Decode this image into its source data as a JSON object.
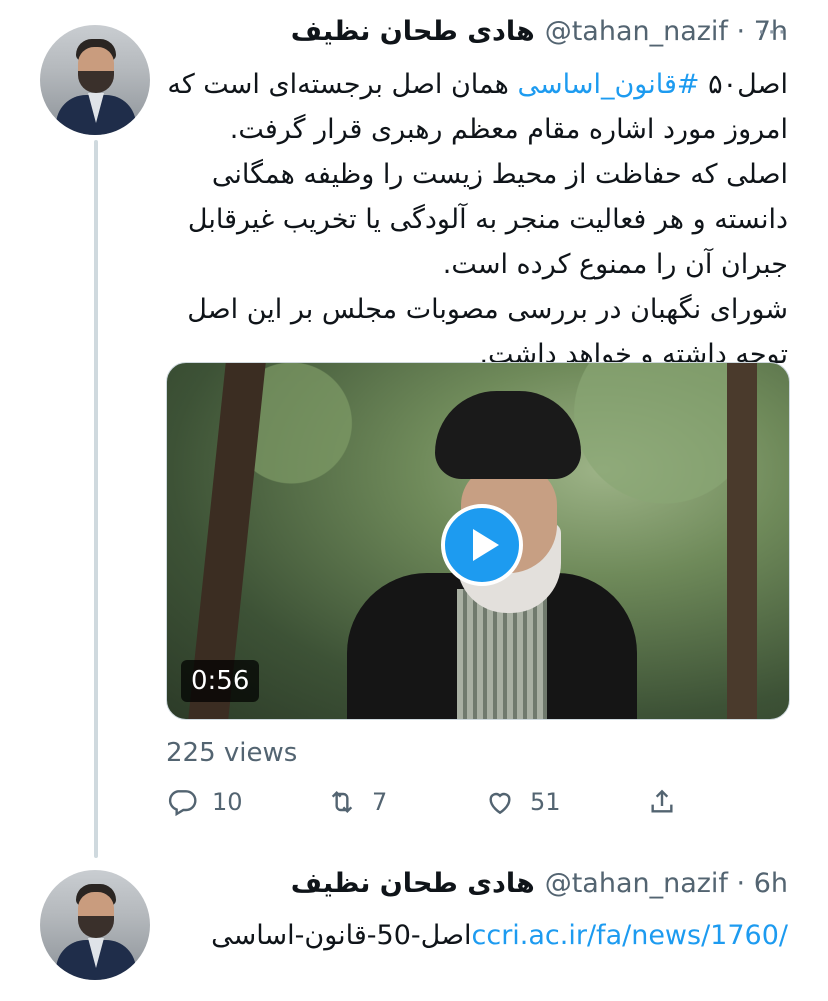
{
  "tweet1": {
    "name": "هادی طحان نظیف",
    "handle": "@tahan_nazif",
    "time": "7h",
    "more": "···",
    "text_prefix": "اصل۵۰ ",
    "hashtag": "#قانون_اساسی",
    "text_rest": " همان اصل برجسته‌ای است که امروز مورد اشاره مقام معظم رهبری قرار گرفت.",
    "text_line2": "اصلی که حفاظت از محیط زیست را وظیفه همگانی دانسته و هر فعالیت منجر به آلودگی یا تخریب غیرقابل جبران آن را ممنوع کرده است.",
    "text_line3": "شورای نگهبان در بررسی مصوبات مجلس بر این اصل توجه داشته و خواهد داشت.",
    "video_duration": "0:56",
    "views": "225 views",
    "replies": "10",
    "retweets": "7",
    "likes": "51"
  },
  "tweet2": {
    "name": "هادی طحان نظیف",
    "handle": "@tahan_nazif",
    "time": "6h",
    "link_text": "ccri.ac.ir/fa/news/1760/",
    "text_after": "اصل-50-قانون-اساسی"
  },
  "colors": {
    "link": "#1d9bf0",
    "muted": "#536471",
    "text": "#0f1419",
    "thread_line": "#cfd9de"
  },
  "icons": [
    "reply-icon",
    "retweet-icon",
    "like-icon",
    "share-icon",
    "play-icon",
    "more-icon"
  ]
}
